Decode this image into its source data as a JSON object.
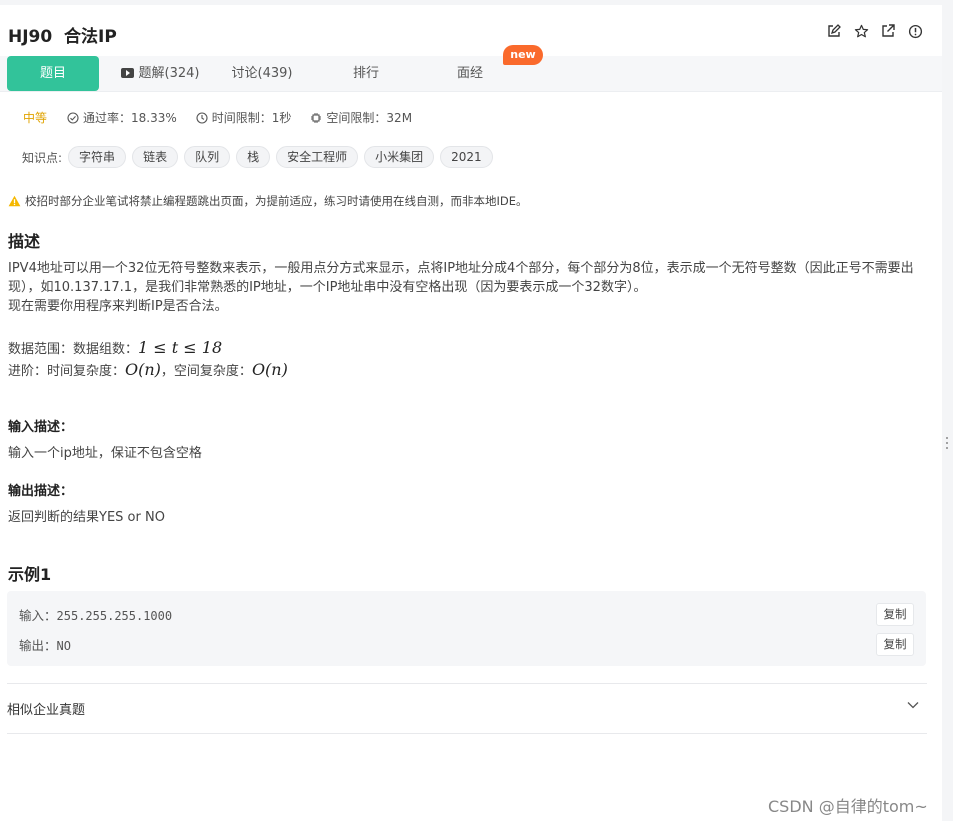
{
  "problem": {
    "title": "HJ90  合法IP"
  },
  "tabs": [
    {
      "label": "题目"
    },
    {
      "label": "题解(324)"
    },
    {
      "label": "讨论(439)"
    },
    {
      "label": "排行"
    },
    {
      "label": "面经"
    }
  ],
  "new_badge": "new",
  "meta": {
    "difficulty": "中等",
    "pass_rate": "通过率：18.33%",
    "time_limit": "时间限制：1秒",
    "memory_limit": "空间限制：32M"
  },
  "knowledge": {
    "label": "知识点:",
    "tags": [
      "字符串",
      "链表",
      "队列",
      "栈",
      "安全工程师",
      "小米集团",
      "2021"
    ]
  },
  "notice": "校招时部分企业笔试将禁止编程题跳出页面，为提前适应，练习时请使用在线自测，而非本地IDE。",
  "description": {
    "heading": "描述",
    "line1": "IPV4地址可以用一个32位无符号整数来表示，一般用点分方式来显示，点将IP地址分成4个部分，每个部分为8位，表示成一个无符号整数（因此正号不需要出现），如10.137.17.1，是我们非常熟悉的IP地址，一个IP地址串中没有空格出现（因为要表示成一个32数字）。",
    "line2": "现在需要你用程序来判断IP是否合法。",
    "range_label": "数据范围：数据组数：",
    "range_math": "1 ≤ t ≤ 18",
    "advanced_label": "进阶：时间复杂度：",
    "time_math": "O(n)",
    "space_label": "，空间复杂度：",
    "space_math": "O(n)"
  },
  "input_desc": {
    "heading": "输入描述：",
    "text": "输入一个ip地址，保证不包含空格"
  },
  "output_desc": {
    "heading": "输出描述：",
    "text": "返回判断的结果YES or NO"
  },
  "example": {
    "heading": "示例1",
    "input_label": "输入：",
    "input_value": "255.255.255.1000",
    "output_label": "输出：",
    "output_value": "NO",
    "copy_label": "复制"
  },
  "similar": {
    "label": "相似企业真题"
  },
  "watermark": "CSDN @自律的tom~",
  "colors": {
    "accent": "#32c39a",
    "difficulty": "#e0a300",
    "new_badge": "#fa6a2c",
    "warning": "#f5b800"
  }
}
